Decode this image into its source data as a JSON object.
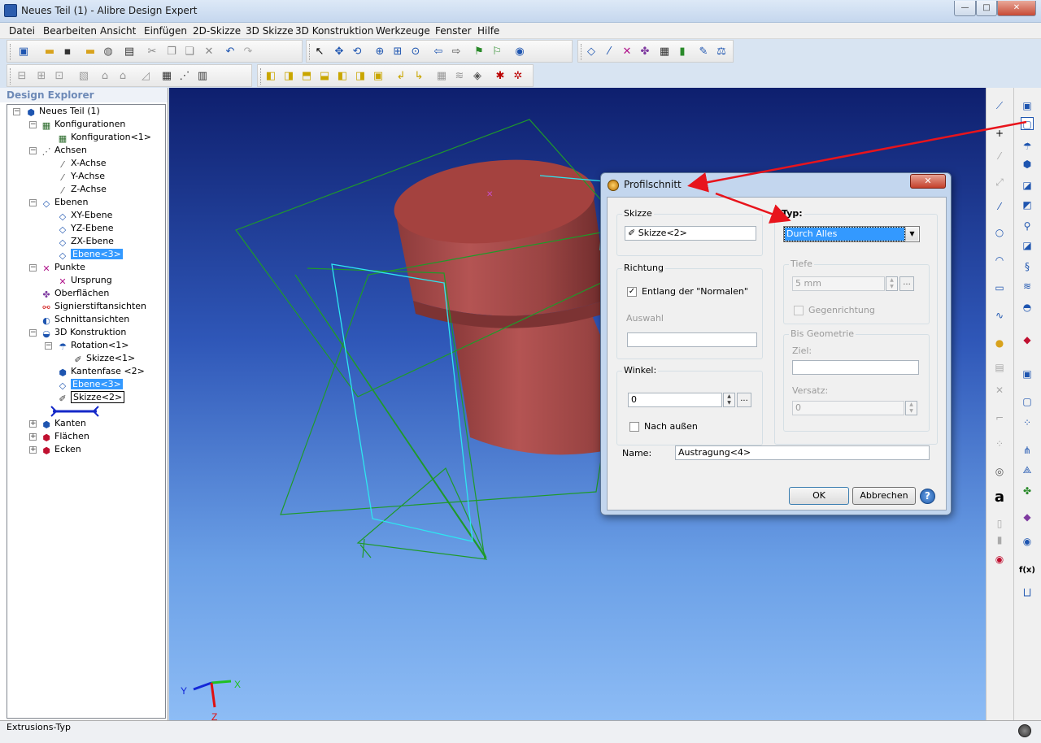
{
  "window": {
    "title": "Neues Teil (1) - Alibre Design Expert",
    "minimize": "—",
    "maximize": "□",
    "close": "✕"
  },
  "menu": [
    "Datei",
    "Bearbeiten",
    "Ansicht",
    "Einfügen",
    "2D-Skizze",
    "3D Skizze",
    "3D Konstruktion",
    "Werkzeuge",
    "Fenster",
    "Hilfe"
  ],
  "explorer": {
    "title": "Design Explorer",
    "nodes": [
      {
        "label": "Neues Teil (1)",
        "icon": "part-icon"
      },
      {
        "label": "Konfigurationen",
        "icon": "configurations-icon"
      },
      {
        "label": "Konfiguration<1>",
        "icon": "configuration-icon"
      },
      {
        "label": "Achsen",
        "icon": "axes-icon"
      },
      {
        "label": "X-Achse",
        "icon": "axis-icon"
      },
      {
        "label": "Y-Achse",
        "icon": "axis-icon"
      },
      {
        "label": "Z-Achse",
        "icon": "axis-icon"
      },
      {
        "label": "Ebenen",
        "icon": "planes-icon"
      },
      {
        "label": "XY-Ebene",
        "icon": "plane-icon"
      },
      {
        "label": "YZ-Ebene",
        "icon": "plane-icon"
      },
      {
        "label": "ZX-Ebene",
        "icon": "plane-icon"
      },
      {
        "label": "Ebene<3>",
        "icon": "plane-icon"
      },
      {
        "label": "Punkte",
        "icon": "points-icon"
      },
      {
        "label": "Ursprung",
        "icon": "origin-icon"
      },
      {
        "label": "Oberflächen",
        "icon": "surfaces-icon"
      },
      {
        "label": "Signierstiftansichten",
        "icon": "redline-icon"
      },
      {
        "label": "Schnittansichten",
        "icon": "section-icon"
      },
      {
        "label": "3D Konstruktion",
        "icon": "feature-icon"
      },
      {
        "label": "Rotation<1>",
        "icon": "revolve-icon"
      },
      {
        "label": "Skizze<1>",
        "icon": "sketch-icon"
      },
      {
        "label": "Kantenfase <2>",
        "icon": "chamfer-icon"
      },
      {
        "label": "Ebene<3>",
        "icon": "plane-icon"
      },
      {
        "label": "Skizze<2>",
        "icon": "sketch-icon"
      },
      {
        "label": "Kanten",
        "icon": "edges-icon"
      },
      {
        "label": "Flächen",
        "icon": "faces-icon"
      },
      {
        "label": "Ecken",
        "icon": "vertices-icon"
      }
    ]
  },
  "viewport": {
    "triad": {
      "x": "X",
      "y": "Y",
      "z": "Z"
    }
  },
  "dialog": {
    "title": "Profilschnitt",
    "skizze": {
      "legend": "Skizze",
      "value": "Skizze<2>"
    },
    "richtung": {
      "legend": "Richtung",
      "normal_label": "Entlang der \"Normalen\"",
      "normal_checked": true,
      "auswahl_label": "Auswahl",
      "auswahl_value": ""
    },
    "winkel": {
      "legend": "Winkel:",
      "value": "0",
      "nach_aussen_label": "Nach außen",
      "nach_aussen_checked": false
    },
    "typ": {
      "legend": "Typ:",
      "value": "Durch Alles"
    },
    "tiefe": {
      "legend": "Tiefe",
      "value": "5 mm",
      "gegenrichtung_label": "Gegenrichtung"
    },
    "bis_geometrie": {
      "legend": "Bis Geometrie",
      "ziel_label": "Ziel:",
      "ziel_value": "",
      "versatz_label": "Versatz:",
      "versatz_value": "0"
    },
    "name_label": "Name:",
    "name_value": "Austragung<4>",
    "ok": "OK",
    "cancel": "Abbrechen",
    "help": "?"
  },
  "status": {
    "text": "Extrusions-Typ"
  },
  "colors": {
    "annotation_arrow": "#e8141c",
    "model": "#a84a49",
    "plane_green": "#1f9a2a",
    "sketch_cyan": "#2ee6f0"
  }
}
